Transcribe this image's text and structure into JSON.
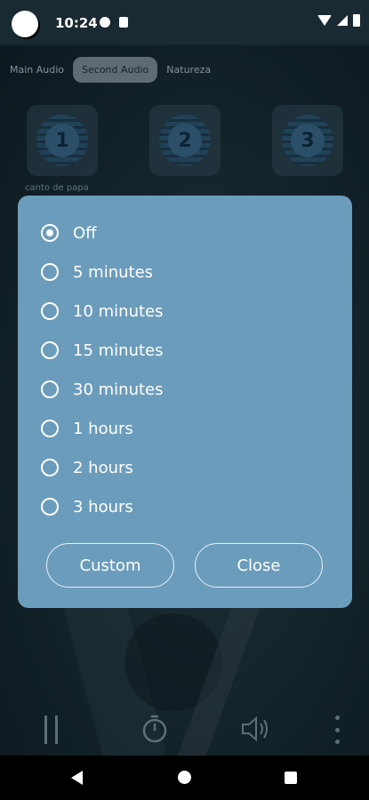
{
  "status_bar": {
    "time": "10:24"
  },
  "tabs": [
    {
      "label": "Main Audio",
      "active": false
    },
    {
      "label": "Second Audio",
      "active": true
    },
    {
      "label": "Natureza",
      "active": false
    }
  ],
  "tiles": [
    {
      "number": "1",
      "label": "canto de papa"
    },
    {
      "number": "2",
      "label": ""
    },
    {
      "number": "3",
      "label": ""
    }
  ],
  "dialog": {
    "options": [
      {
        "label": "Off",
        "selected": true
      },
      {
        "label": "5 minutes",
        "selected": false
      },
      {
        "label": "10 minutes",
        "selected": false
      },
      {
        "label": "15 minutes",
        "selected": false
      },
      {
        "label": "30 minutes",
        "selected": false
      },
      {
        "label": "1 hours",
        "selected": false
      },
      {
        "label": "2 hours",
        "selected": false
      },
      {
        "label": "3 hours",
        "selected": false
      }
    ],
    "custom_label": "Custom",
    "close_label": "Close"
  },
  "colors": {
    "dialog_bg": "#6b9cbb",
    "status_bg": "#1a2a32",
    "tab_active_bg": "#8d9aa1"
  },
  "icons": {
    "player": [
      "pause-icon",
      "timer-icon",
      "volume-icon",
      "more-vert-icon"
    ],
    "nav": [
      "back-icon",
      "home-icon",
      "recents-icon"
    ]
  }
}
